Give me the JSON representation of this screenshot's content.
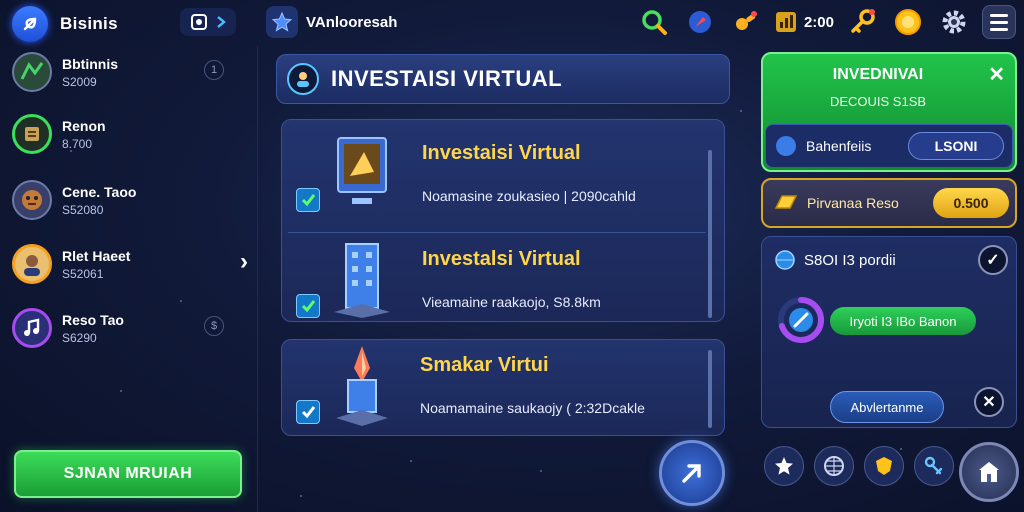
{
  "app": {
    "title": "Bisinis",
    "account_name": "VAnlooresah",
    "counter": "2:00",
    "colors": {
      "accent_green": "#2ecc55",
      "accent_gold": "#ffd54a",
      "panel_blue": "#1c2c62"
    }
  },
  "topbar_icons": [
    "search-icon",
    "rocket-icon",
    "key-icon",
    "chart-icon",
    "key-gold-icon",
    "coin-icon",
    "gear-icon",
    "menu-icon"
  ],
  "sidebar": {
    "friends": [
      {
        "name": "Bbtinnis",
        "sub": "S2009",
        "avatar": "map-avatar"
      },
      {
        "name": "Renon",
        "sub": "8.700",
        "avatar": "coin-stack-avatar"
      },
      {
        "name": "Cene. Taoo",
        "sub": "S52080",
        "avatar": "face-avatar"
      },
      {
        "name": "Rlet Haeet",
        "sub": "S52061",
        "avatar": "person-avatar"
      },
      {
        "name": "Reso Tao",
        "sub": "S6290",
        "avatar": "music-avatar"
      }
    ],
    "button_label": "SJNAN MRUIAH"
  },
  "main": {
    "header_title": "INVESTAISI VIRTUAL",
    "cards": [
      {
        "title": "Investaisi Virtual",
        "desc": "Noamasine zoukasieo | 2090cahld",
        "icon": "monitor-icon"
      },
      {
        "title": "Investalsi Virtual",
        "desc": "Vieamaine raakaojo, S8.8km",
        "icon": "building-icon"
      },
      {
        "title": "Smakar Virtui",
        "desc": "Noamamaine saukaojy ( 2:32Dcakle",
        "icon": "crystal-icon"
      }
    ]
  },
  "right": {
    "top_title": "INVEDNIVAI",
    "top_sub": "DECOUIS S1SB",
    "inner_label": "Bahenfeiis",
    "inner_value": "LSONI",
    "gold_label": "Pirvanaa Reso",
    "gold_value": "0.500",
    "panel_title": "S8OI I3 pordii",
    "progress_label": "Iryoti I3 IBo Banon",
    "progress_fraction": 0.7,
    "action_label": "Abvlertanme"
  }
}
